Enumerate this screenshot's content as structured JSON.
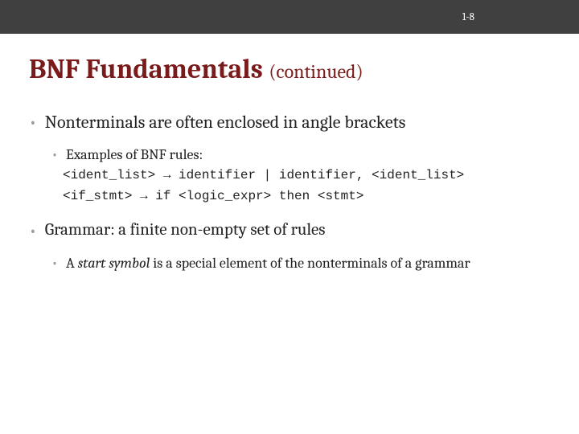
{
  "header": {
    "page_number": "1-8"
  },
  "title": {
    "main": "BNF Fundamentals ",
    "sub": "(continued)"
  },
  "bullets": {
    "nonterminals": "Nonterminals are often enclosed in angle brackets",
    "examples_label": "Examples of BNF rules:",
    "code_line1": "<ident_list> → identifier | identifier, <ident_list>",
    "code_line2": "<if_stmt> → if <logic_expr> then <stmt>",
    "grammar": "Grammar: a finite non-empty set of rules",
    "start_symbol_prefix": "A ",
    "start_symbol_italic": "start symbol",
    "start_symbol_suffix": " is a special element of the nonterminals of a grammar"
  }
}
